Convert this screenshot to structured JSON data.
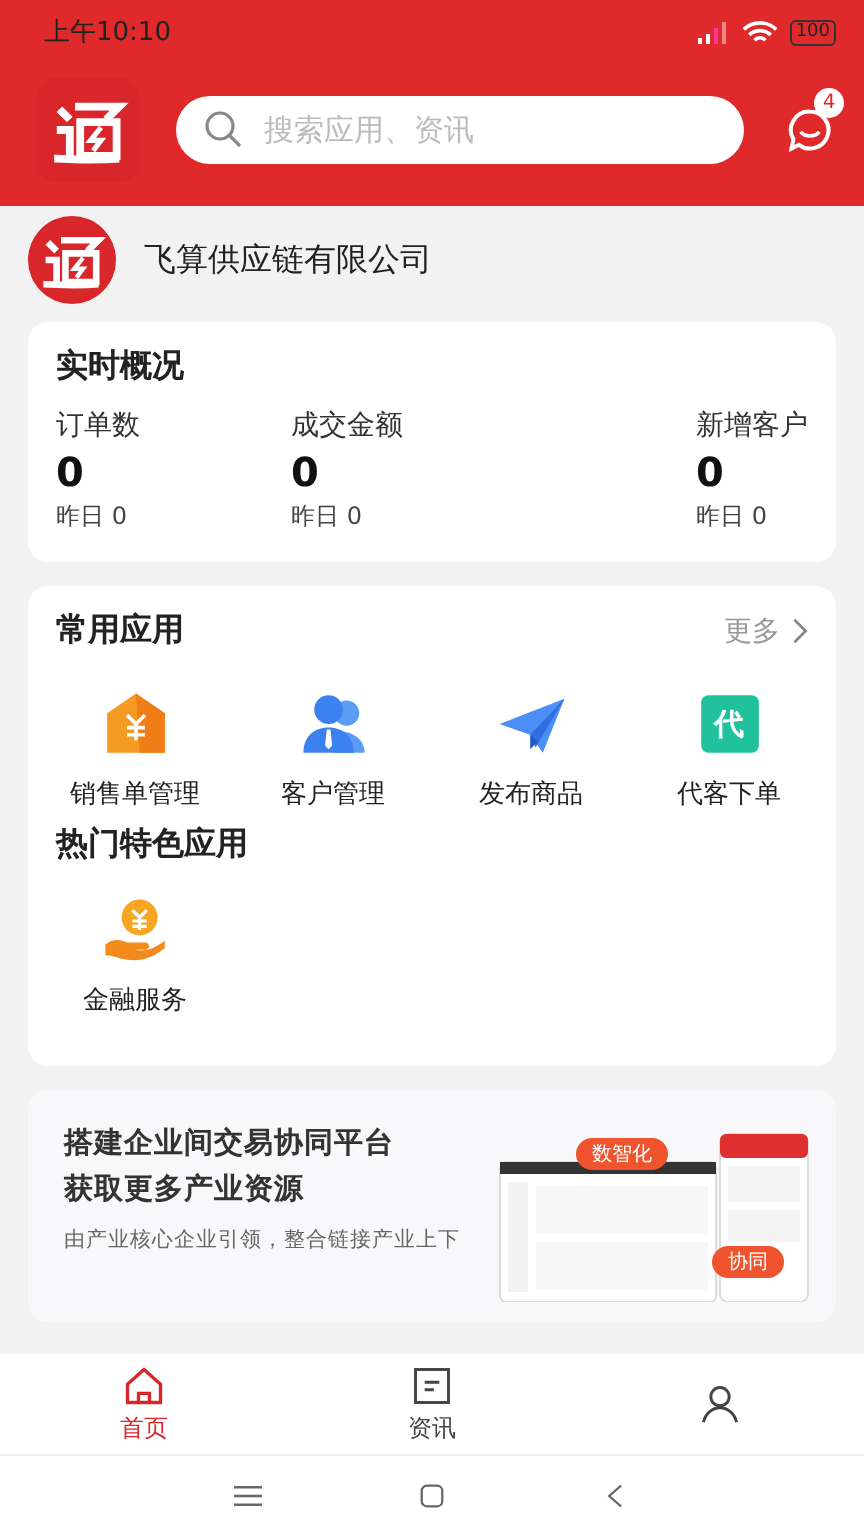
{
  "status_bar": {
    "time": "上午10:10",
    "battery": "100"
  },
  "header": {
    "search": {
      "placeholder": "搜索应用、资讯"
    },
    "message_badge": "4"
  },
  "company": {
    "name": "飞算供应链有限公司"
  },
  "overview": {
    "title": "实时概况",
    "stats": [
      {
        "label": "订单数",
        "value": "0",
        "yesterday": "昨日 0"
      },
      {
        "label": "成交金额",
        "value": "0",
        "yesterday": "昨日 0"
      },
      {
        "label": "新增客户",
        "value": "0",
        "yesterday": "昨日 0"
      }
    ]
  },
  "common_apps": {
    "title": "常用应用",
    "more": "更多",
    "items": [
      {
        "kind": "invoice",
        "label": "销售单管理"
      },
      {
        "kind": "customer",
        "label": "客户管理"
      },
      {
        "kind": "publish",
        "label": "发布商品"
      },
      {
        "kind": "proxy",
        "label": "代客下单",
        "icon_text": "代"
      }
    ]
  },
  "featured_apps": {
    "title": "热门特色应用",
    "items": [
      {
        "kind": "finance",
        "label": "金融服务"
      }
    ]
  },
  "banner": {
    "title_lines": [
      "搭建企业间交易协同平台",
      "获取更多产业资源"
    ],
    "body": "由产业核心企业引领，整合链接产业上下",
    "tags": [
      "数智化",
      "协同"
    ]
  },
  "tab_bar": [
    {
      "kind": "home",
      "label": "首页",
      "selected": true
    },
    {
      "kind": "news",
      "label": "资讯",
      "selected": false
    },
    {
      "kind": "profile",
      "selected": false
    }
  ]
}
